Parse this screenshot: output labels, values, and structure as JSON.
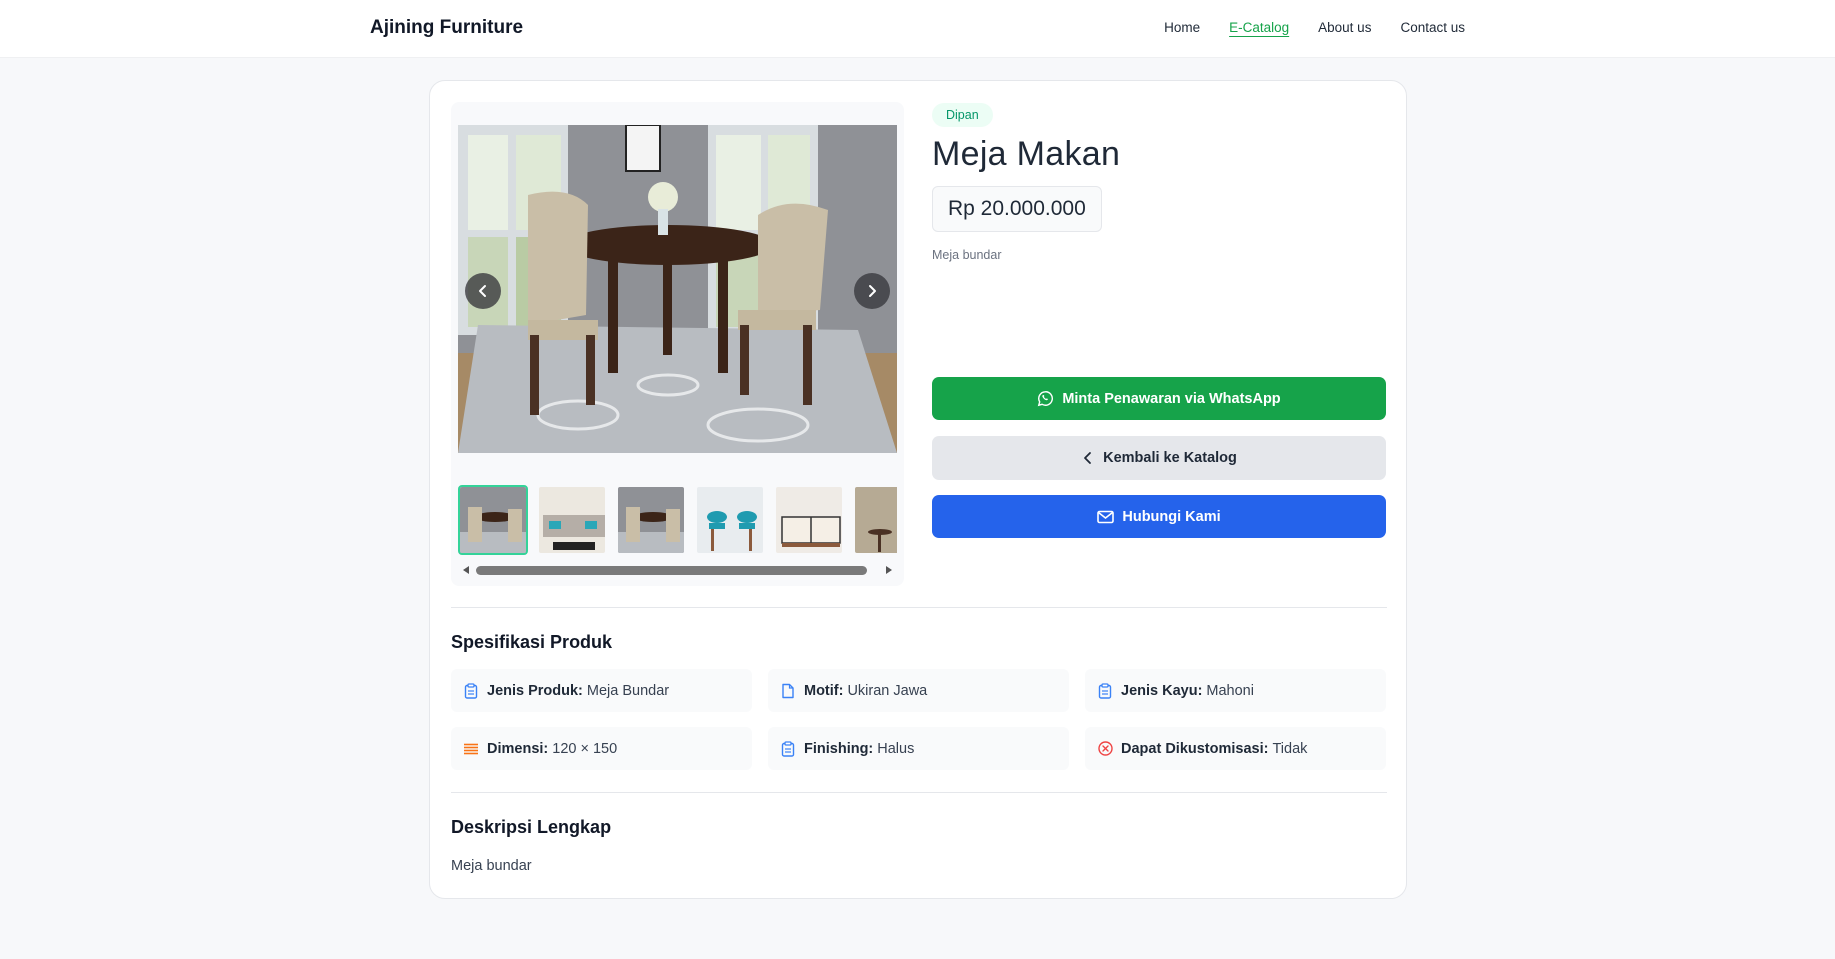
{
  "navbar": {
    "brand": "Ajining Furniture",
    "links": [
      "Home",
      "E-Catalog",
      "About us",
      "Contact us"
    ],
    "active": "E-Catalog"
  },
  "product": {
    "category": "Dipan",
    "name": "Meja Makan",
    "price": "Rp 20.000.000",
    "short_description": "Meja bundar"
  },
  "buttons": {
    "whatsapp": "Minta Penawaran via WhatsApp",
    "back": "Kembali ke Katalog",
    "contact": "Hubungi Kami"
  },
  "gallery": {
    "active_thumb_index": 0,
    "thumbnail_count": 6
  },
  "specs": {
    "title": "Spesifikasi Produk",
    "items": [
      {
        "label": "Jenis Produk:",
        "value": "Meja Bundar",
        "icon": "clipboard-icon"
      },
      {
        "label": "Motif:",
        "value": "Ukiran Jawa",
        "icon": "document-icon"
      },
      {
        "label": "Jenis Kayu:",
        "value": "Mahoni",
        "icon": "clipboard-icon"
      },
      {
        "label": "Dimensi:",
        "value": "120 × 150",
        "icon": "lines-icon"
      },
      {
        "label": "Finishing:",
        "value": "Halus",
        "icon": "clipboard-icon"
      },
      {
        "label": "Dapat Dikustomisasi:",
        "value": "Tidak",
        "icon": "x-circle-icon"
      }
    ]
  },
  "description": {
    "title": "Deskripsi Lengkap",
    "text": "Meja bundar"
  },
  "colors": {
    "green": "#16a34a",
    "blue": "#2563eb",
    "icon_blue": "#3b82f6",
    "icon_orange": "#f97316",
    "icon_red": "#ef4444"
  }
}
